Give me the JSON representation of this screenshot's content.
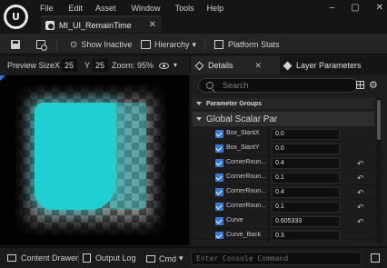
{
  "menu": {
    "items": [
      "File",
      "Edit",
      "Asset",
      "Window",
      "Tools",
      "Help"
    ]
  },
  "window": {
    "minimize": "–",
    "maximize": "▢",
    "close": "✕"
  },
  "asset_tab": {
    "label": "MI_UI_RemainTime",
    "close": "✕"
  },
  "toolbar": {
    "show_inactive": "Show Inactive",
    "hierarchy": "Hierarchy",
    "hierarchy_caret": "▾",
    "platform_stats": "Platform Stats"
  },
  "viewport": {
    "preview_label": "Preview Size",
    "x_label": "X",
    "x_value": "25",
    "y_label": "Y",
    "y_value": "25",
    "zoom": "Zoom: 95%",
    "caret": "▾"
  },
  "details": {
    "tab_details": "Details",
    "tab_layers": "Layer Parameters",
    "tab_close": "✕",
    "search_placeholder": "Search",
    "gear": "⚙",
    "group_parameter": "Parameter Groups",
    "group_scalar": "Global Scalar Par",
    "rows": [
      {
        "name": "Box_SlantX",
        "value": "0.0",
        "reset": ""
      },
      {
        "name": "Box_SlantY",
        "value": "0.0",
        "reset": ""
      },
      {
        "name": "CornerRoun...",
        "value": "0.4",
        "reset": "↶"
      },
      {
        "name": "CornerRoun...",
        "value": "0.1",
        "reset": "↶"
      },
      {
        "name": "CornerRoun...",
        "value": "0.4",
        "reset": "↶"
      },
      {
        "name": "CornerRoun...",
        "value": "0.1",
        "reset": "↶"
      },
      {
        "name": "Curve",
        "value": "0.605333",
        "reset": "↶"
      },
      {
        "name": "Curve_Back",
        "value": "0.3",
        "reset": ""
      }
    ]
  },
  "statusbar": {
    "content_drawer": "Content Drawer",
    "output_log": "Output Log",
    "cmd": "Cmd",
    "cmd_caret": "▾",
    "console_placeholder": "Enter Console Command"
  }
}
